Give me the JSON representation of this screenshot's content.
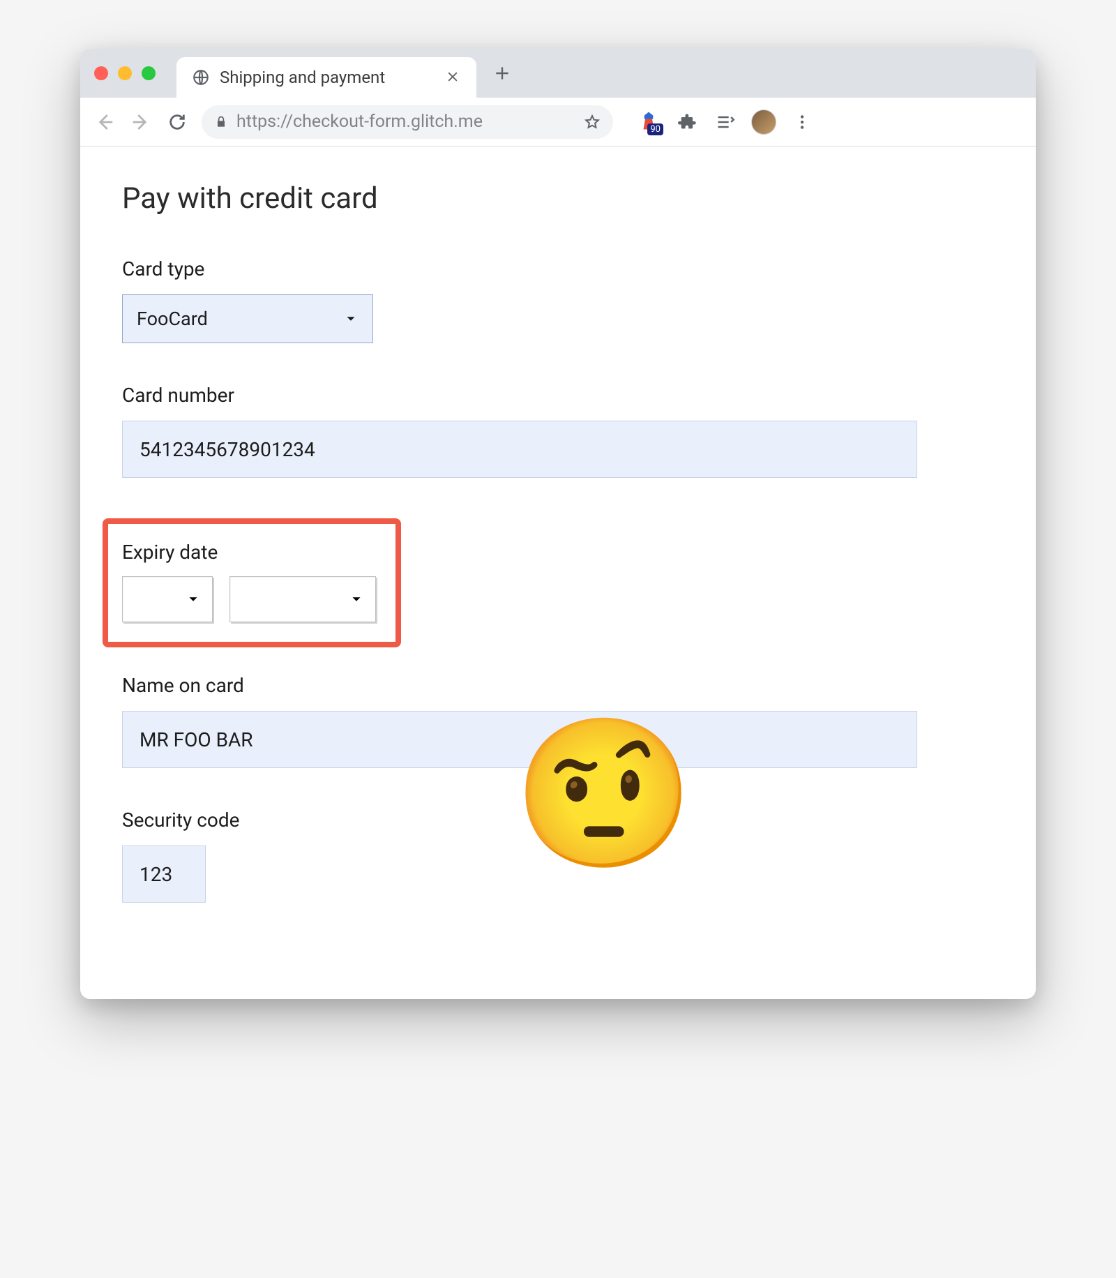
{
  "browser": {
    "tab_title": "Shipping and payment",
    "url_display": "https://checkout-form.glitch.me",
    "lighthouse_score": "90"
  },
  "page": {
    "heading": "Pay with credit card",
    "card_type": {
      "label": "Card type",
      "value": "FooCard"
    },
    "card_number": {
      "label": "Card number",
      "value": "5412345678901234"
    },
    "expiry": {
      "label": "Expiry date",
      "month": "",
      "year": ""
    },
    "name_on_card": {
      "label": "Name on card",
      "value": "MR FOO BAR"
    },
    "security_code": {
      "label": "Security code",
      "value": "123"
    },
    "annotation": {
      "highlight_color": "#ef5a46",
      "emoji": "🤨"
    }
  }
}
